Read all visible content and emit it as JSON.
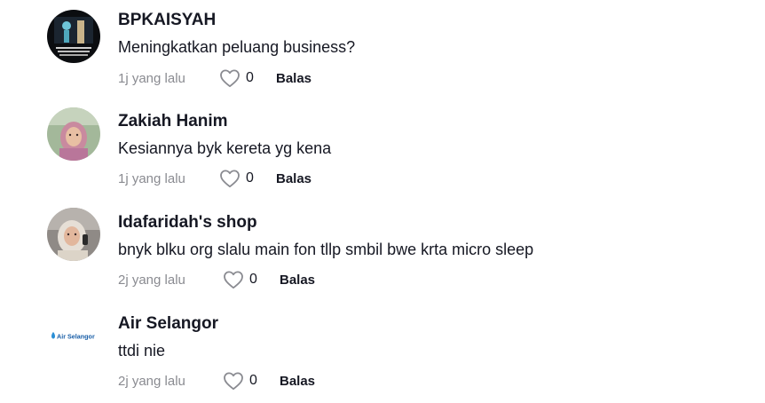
{
  "comments": [
    {
      "username": "BPKAISYAH",
      "text": "Meningkatkan peluang business?",
      "time": "1j yang lalu",
      "likes": "0",
      "reply_label": "Balas"
    },
    {
      "username": "Zakiah Hanim",
      "text": "Kesiannya byk kereta yg kena",
      "time": "1j yang lalu",
      "likes": "0",
      "reply_label": "Balas"
    },
    {
      "username": "Idafaridah's shop",
      "text": "bnyk blku org slalu main fon tllp smbil bwe krta micro sleep",
      "time": "2j yang lalu",
      "likes": "0",
      "reply_label": "Balas"
    },
    {
      "username": "Air Selangor",
      "text": "ttdi nie",
      "time": "2j yang lalu",
      "likes": "0",
      "reply_label": "Balas",
      "avatar_logo_text": "Air Selangor"
    }
  ],
  "icons": {
    "like": "heart-outline-icon"
  },
  "colors": {
    "text_primary": "#161823",
    "text_secondary": "#8a8b91",
    "air_selangor_brand": "#1a5fa8"
  }
}
